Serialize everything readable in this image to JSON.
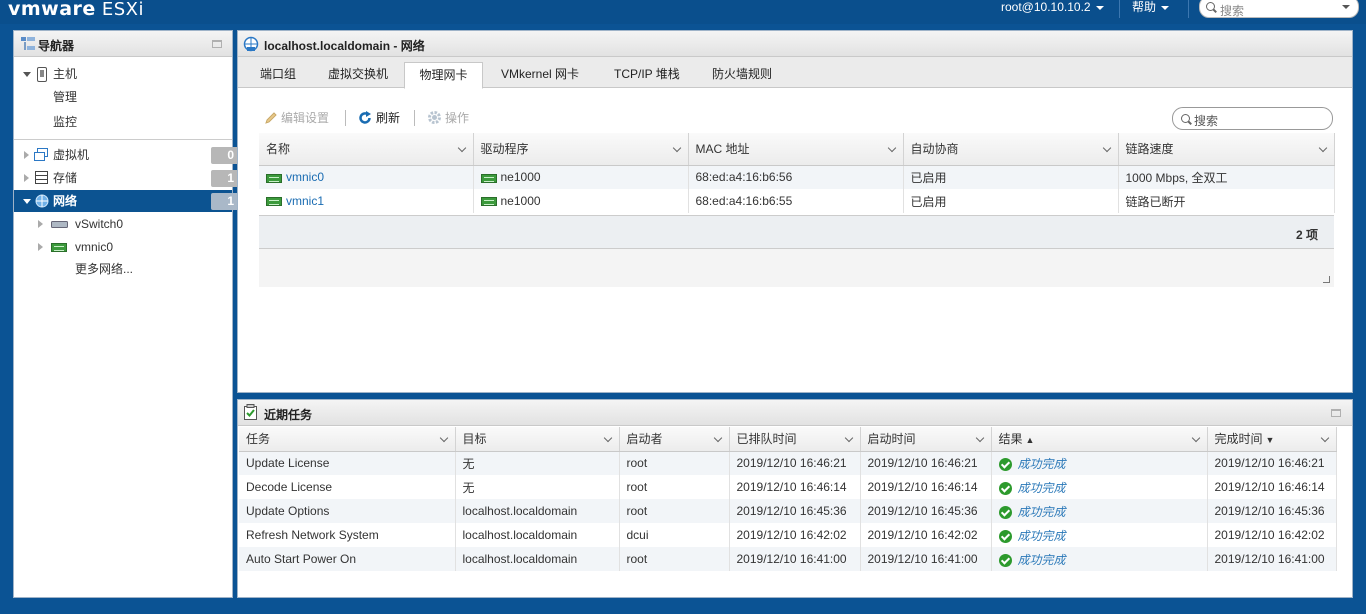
{
  "app": {
    "brand": "vmware",
    "product": "ESXi"
  },
  "topbar": {
    "user": "root@10.10.10.2",
    "help": "帮助",
    "search_placeholder": "搜索"
  },
  "navigator": {
    "title": "导航器",
    "host": {
      "label": "主机",
      "children": [
        "管理",
        "监控"
      ]
    },
    "items": [
      {
        "label": "虚拟机",
        "count": "0"
      },
      {
        "label": "存储",
        "count": "1"
      },
      {
        "label": "网络",
        "count": "1"
      }
    ],
    "network_children": [
      "vSwitch0",
      "vmnic0"
    ],
    "more": "更多网络..."
  },
  "main": {
    "title": "localhost.localdomain - 网络",
    "tabs": [
      "端口组",
      "虚拟交换机",
      "物理网卡",
      "VMkernel 网卡",
      "TCP/IP 堆栈",
      "防火墙规则"
    ],
    "active_tab": "物理网卡",
    "toolbar": {
      "edit": "编辑设置",
      "refresh": "刷新",
      "actions": "操作",
      "search_placeholder": "搜索"
    },
    "columns": [
      "名称",
      "驱动程序",
      "MAC 地址",
      "自动协商",
      "链路速度"
    ],
    "rows": [
      {
        "name": "vmnic0",
        "driver": "ne1000",
        "mac": "68:ed:a4:16:b6:56",
        "auto": "已启用",
        "speed": "1000 Mbps, 全双工"
      },
      {
        "name": "vmnic1",
        "driver": "ne1000",
        "mac": "68:ed:a4:16:b6:55",
        "auto": "已启用",
        "speed": "链路已断开"
      }
    ],
    "count": "2 项"
  },
  "tasks": {
    "title": "近期任务",
    "columns": [
      "任务",
      "目标",
      "启动者",
      "已排队时间",
      "启动时间",
      "结果",
      "完成时间"
    ],
    "rows": [
      {
        "task": "Update License",
        "target": "无",
        "initiator": "root",
        "queued": "2019/12/10 16:46:21",
        "started": "2019/12/10 16:46:21",
        "result": "成功完成",
        "completed": "2019/12/10 16:46:21"
      },
      {
        "task": "Decode License",
        "target": "无",
        "initiator": "root",
        "queued": "2019/12/10 16:46:14",
        "started": "2019/12/10 16:46:14",
        "result": "成功完成",
        "completed": "2019/12/10 16:46:14"
      },
      {
        "task": "Update Options",
        "target": "localhost.localdomain",
        "initiator": "root",
        "queued": "2019/12/10 16:45:36",
        "started": "2019/12/10 16:45:36",
        "result": "成功完成",
        "completed": "2019/12/10 16:45:36"
      },
      {
        "task": "Refresh Network System",
        "target": "localhost.localdomain",
        "initiator": "dcui",
        "queued": "2019/12/10 16:42:02",
        "started": "2019/12/10 16:42:02",
        "result": "成功完成",
        "completed": "2019/12/10 16:42:02"
      },
      {
        "task": "Auto Start Power On",
        "target": "localhost.localdomain",
        "initiator": "root",
        "queued": "2019/12/10 16:41:00",
        "started": "2019/12/10 16:41:00",
        "result": "成功完成",
        "completed": "2019/12/10 16:41:00"
      }
    ]
  },
  "colors": {
    "brand_blue": "#0a4f8d",
    "selected": "#0c5391",
    "success": "#2d9a2d",
    "link": "#1a6cb2"
  }
}
